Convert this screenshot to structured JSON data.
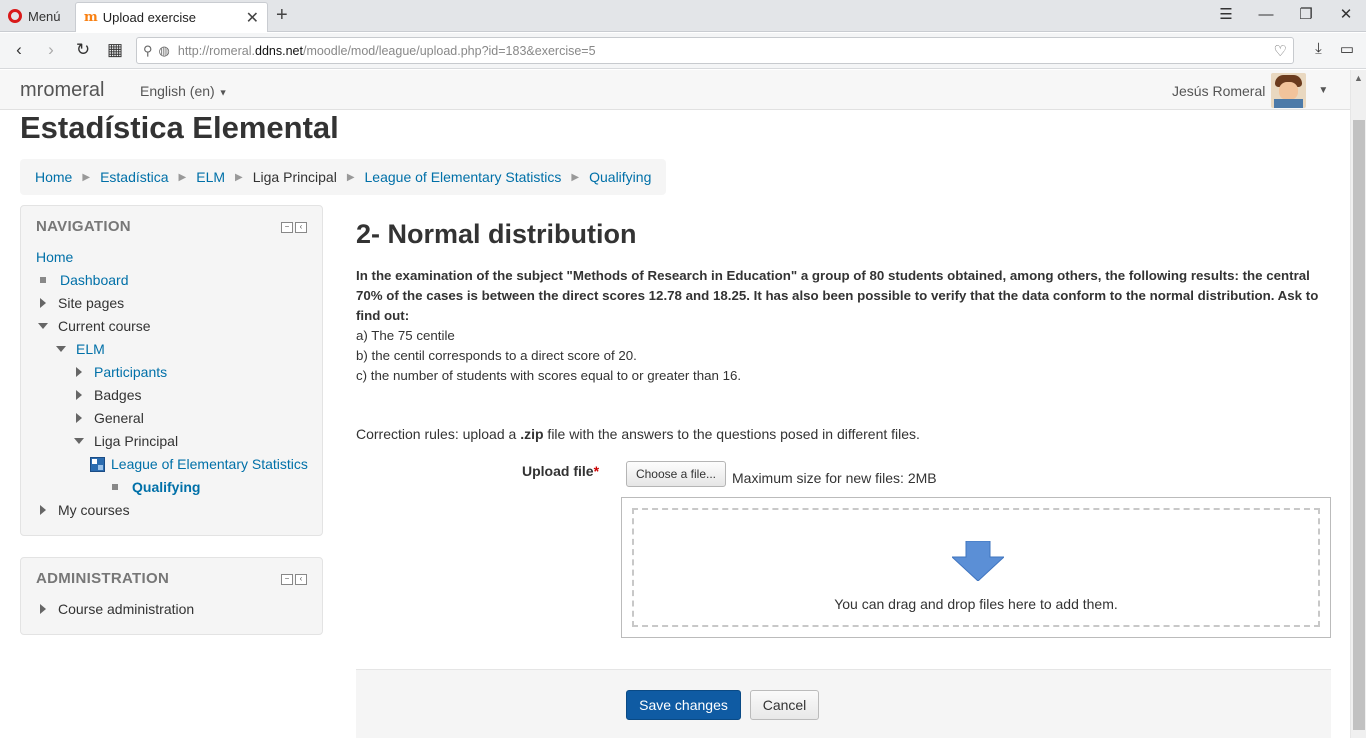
{
  "browser": {
    "menu_label": "Menú",
    "tab_title": "Upload exercise",
    "new_tab_glyph": "+",
    "url_prefix": "http://romeral.",
    "url_host": "ddns.net",
    "url_path": "/moodle/mod/league/upload.php?id=183&exercise=5"
  },
  "navbar": {
    "brand": "mromeral",
    "language": "English (en)",
    "user_name": "Jesús Romeral"
  },
  "page": {
    "title": "Estadística Elemental"
  },
  "breadcrumb": {
    "items": [
      {
        "label": "Home",
        "link": true
      },
      {
        "label": "Estadística",
        "link": true
      },
      {
        "label": "ELM",
        "link": true
      },
      {
        "label": "Liga Principal",
        "link": false
      },
      {
        "label": "League of Elementary Statistics",
        "link": true
      },
      {
        "label": "Qualifying",
        "link": true
      }
    ]
  },
  "navigation": {
    "title": "NAVIGATION",
    "home": "Home",
    "dashboard": "Dashboard",
    "site_pages": "Site pages",
    "current_course": "Current course",
    "course": "ELM",
    "participants": "Participants",
    "badges": "Badges",
    "general": "General",
    "liga": "Liga Principal",
    "league": "League of Elementary Statistics",
    "qualifying": "Qualifying",
    "my_courses": "My courses"
  },
  "administration": {
    "title": "ADMINISTRATION",
    "course_admin": "Course administration"
  },
  "exercise": {
    "heading": "2- Normal distribution",
    "statement": "In the examination of the subject \"Methods of Research in Education\" a group of 80 students obtained, among others, the following results: the central 70% of the cases is between the direct scores 12.78 and 18.25. It has also been possible to verify that the data conform to the normal distribution. Ask to find out:",
    "item_a": "a) The 75 centile",
    "item_b": "b) the centil corresponds to a direct score of 20.",
    "item_c": "c) the number of students with scores equal to or greater than 16.",
    "rules_before": "Correction rules: upload a ",
    "rules_ext": ".zip",
    "rules_after": " file with the answers to the questions posed in different files."
  },
  "upload": {
    "label": "Upload file",
    "required_mark": "*",
    "choose_button": "Choose a file...",
    "max_size": "Maximum size for new files: 2MB",
    "drop_text": "You can drag and drop files here to add them."
  },
  "actions": {
    "save": "Save changes",
    "cancel": "Cancel"
  },
  "colors": {
    "link": "#0070a8",
    "primary_button": "#0f5ba3",
    "required": "#cc0000",
    "drop_arrow": "#5b8fd6"
  }
}
